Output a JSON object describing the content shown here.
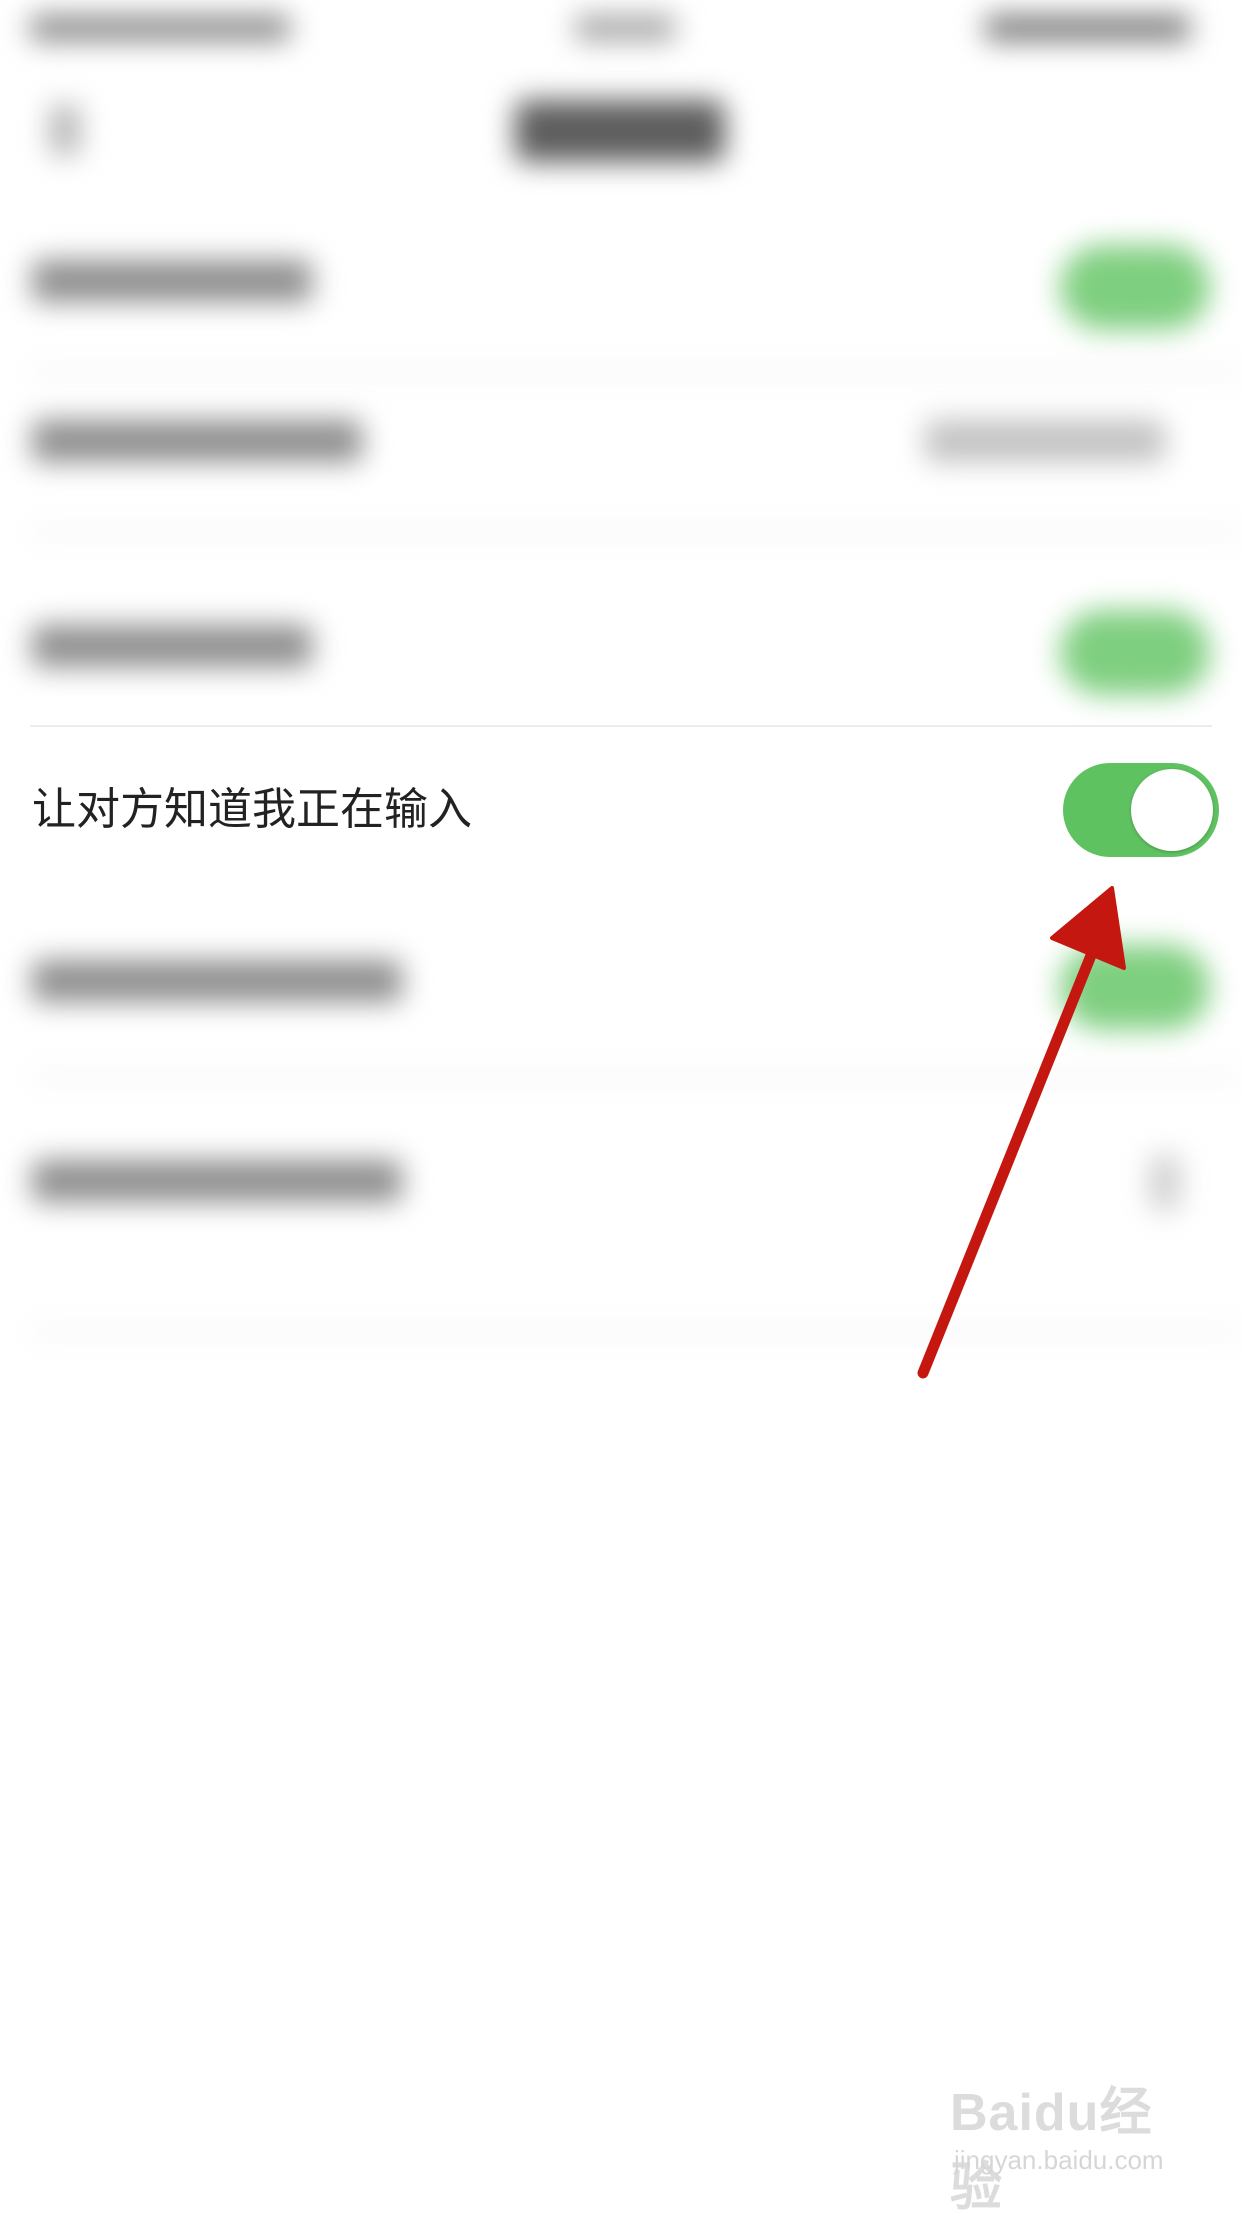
{
  "setting_row": {
    "label": "让对方知道我正在输入",
    "toggle_state": "on",
    "toggle_color": "#5fc261"
  },
  "annotation": {
    "arrow_color": "#c4170f",
    "points_to": "typing-indicator-toggle"
  },
  "watermark": {
    "logo_text": "Baidu经验",
    "url_text": "jingyan.baidu.com"
  }
}
